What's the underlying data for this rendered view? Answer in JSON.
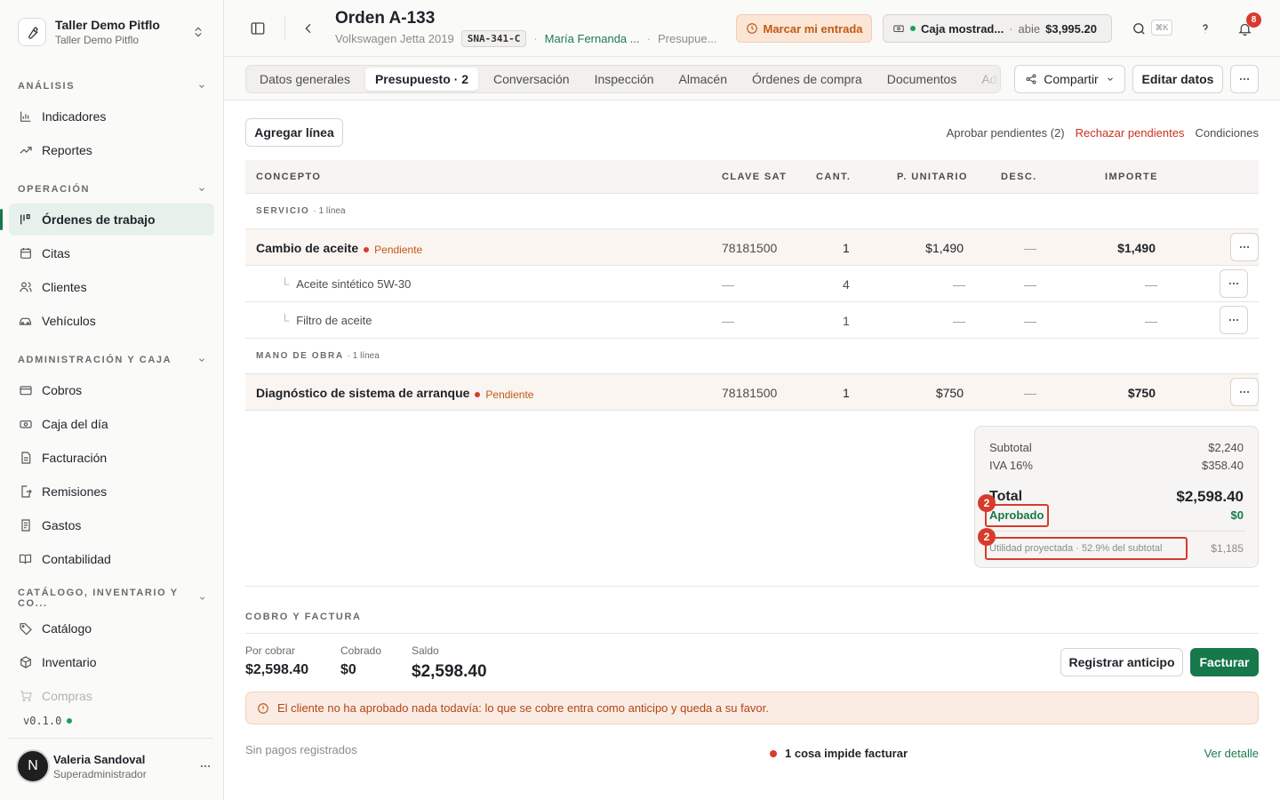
{
  "org": {
    "name": "Taller Demo Pitflo",
    "sub": "Taller Demo Pitflo"
  },
  "sidebar": {
    "sections": [
      {
        "label": "ANÁLISIS"
      },
      {
        "label": "OPERACIÓN"
      },
      {
        "label": "ADMINISTRACIÓN Y CAJA"
      },
      {
        "label": "CATÁLOGO, INVENTARIO Y CO..."
      }
    ],
    "items": [
      {
        "label": "Indicadores"
      },
      {
        "label": "Reportes"
      },
      {
        "label": "Órdenes de trabajo"
      },
      {
        "label": "Citas"
      },
      {
        "label": "Clientes"
      },
      {
        "label": "Vehículos"
      },
      {
        "label": "Cobros"
      },
      {
        "label": "Caja del día"
      },
      {
        "label": "Facturación"
      },
      {
        "label": "Remisiones"
      },
      {
        "label": "Gastos"
      },
      {
        "label": "Contabilidad"
      },
      {
        "label": "Catálogo"
      },
      {
        "label": "Inventario"
      },
      {
        "label": "Compras"
      }
    ],
    "version": "v0.1.0"
  },
  "user": {
    "initial": "N",
    "name": "Valeria Sandoval",
    "role": "Superadministrador"
  },
  "header": {
    "title": "Orden A-133",
    "vehicle": "Volkswagen Jetta 2019",
    "plate": "SNA-341-C",
    "sep": "·",
    "customer": "María Fernanda ...",
    "stage": "Presupue...",
    "marcar": "Marcar mi entrada",
    "caja_name": "Caja mostrad...",
    "caja_status": "abie",
    "caja_amount": "$3,995.20",
    "kbd": "⌘K",
    "notif_count": "8"
  },
  "tabs": [
    {
      "label": "Datos generales"
    },
    {
      "label": "Presupuesto · 2"
    },
    {
      "label": "Conversación"
    },
    {
      "label": "Inspección"
    },
    {
      "label": "Almacén"
    },
    {
      "label": "Órdenes de compra"
    },
    {
      "label": "Documentos"
    },
    {
      "label": "Adjun"
    }
  ],
  "actions": {
    "share": "Compartir",
    "edit": "Editar datos"
  },
  "budget": {
    "add_line": "Agregar línea",
    "approve_pending": "Aprobar pendientes (2)",
    "reject_pending": "Rechazar pendientes",
    "conditions": "Condiciones",
    "columns": [
      "CONCEPTO",
      "CLAVE SAT",
      "CANT.",
      "P. UNITARIO",
      "DESC.",
      "IMPORTE"
    ],
    "groups": [
      {
        "label": "SERVICIO",
        "count": "· 1 línea"
      },
      {
        "label": "MANO DE OBRA",
        "count": "· 1 línea"
      }
    ],
    "rows": [
      {
        "concept": "Cambio de aceite",
        "status": "Pendiente",
        "sat": "78181500",
        "qty": "1",
        "unit": "$1,490",
        "desc": "—",
        "amount": "$1,490"
      },
      {
        "concept": "Aceite sintético 5W-30",
        "sat": "—",
        "qty": "4",
        "unit": "—",
        "desc": "—",
        "amount": "—"
      },
      {
        "concept": "Filtro de aceite",
        "sat": "—",
        "qty": "1",
        "unit": "—",
        "desc": "—",
        "amount": "—"
      },
      {
        "concept": "Diagnóstico de sistema de arranque",
        "status": "Pendiente",
        "sat": "78181500",
        "qty": "1",
        "unit": "$750",
        "desc": "—",
        "amount": "$750"
      }
    ],
    "summary": {
      "subtotal_label": "Subtotal",
      "subtotal": "$2,240",
      "iva_label": "IVA 16%",
      "iva": "$358.40",
      "total_label": "Total",
      "total": "$2,598.40",
      "approved_label": "Aprobado",
      "approved": "$0",
      "profit_label": "Utilidad proyectada · 52.9% del subtotal",
      "profit": "$1,185",
      "marker": "2"
    }
  },
  "billing": {
    "heading": "COBRO Y FACTURA",
    "por_cobrar_label": "Por cobrar",
    "por_cobrar": "$2,598.40",
    "cobrado_label": "Cobrado",
    "cobrado": "$0",
    "saldo_label": "Saldo",
    "saldo": "$2,598.40",
    "register_advance": "Registrar anticipo",
    "invoice": "Facturar",
    "alert": "El cliente no ha aprobado nada todavía: lo que se cobre entra como anticipo y queda a su favor.",
    "no_payments": "Sin pagos registrados",
    "blocker": "1 cosa impide facturar",
    "details": "Ver detalle"
  },
  "colors": {
    "accent": "#17784b",
    "danger": "#d83b2d",
    "warning": "#c25a16"
  }
}
